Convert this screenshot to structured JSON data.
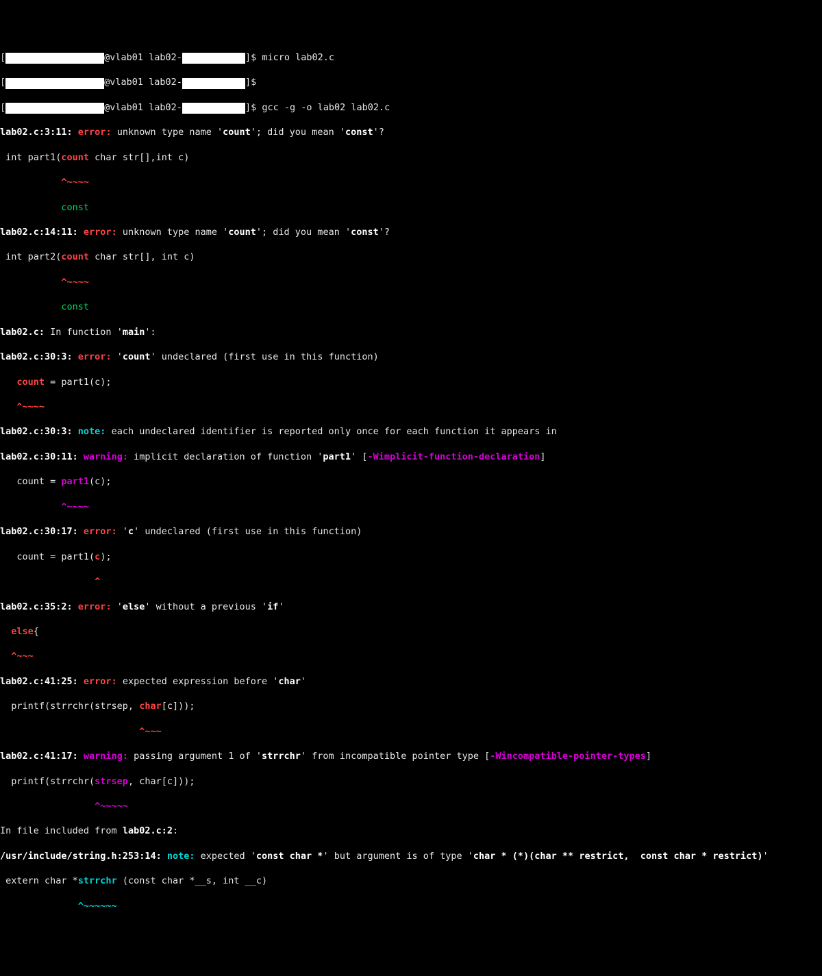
{
  "prompt": {
    "host": "@vlab01 lab02-",
    "dollar": "]$ ",
    "cmd1": "micro lab02.c",
    "cmd2": "",
    "cmd3": "gcc -g -o lab02 lab02.c"
  },
  "err1": {
    "loc": "lab02.c:3:11:",
    "tag": " error: ",
    "msg1": "unknown type name '",
    "kw": "count",
    "msg2": "'; did you mean '",
    "kw2": "const",
    "msg3": "'?",
    "code1": " int part1(",
    "hl": "count",
    "code2": " char str[],int c)",
    "caret": "           ^~~~~",
    "fix": "           const"
  },
  "err2": {
    "loc": "lab02.c:14:11:",
    "tag": " error: ",
    "msg1": "unknown type name '",
    "kw": "count",
    "msg2": "'; did you mean '",
    "kw2": "const",
    "msg3": "'?",
    "code1": " int part2(",
    "hl": "count",
    "code2": " char str[], int c)",
    "caret": "           ^~~~~",
    "fix": "           const"
  },
  "ctx": {
    "loc": "lab02.c:",
    "msg1": " In function '",
    "fn": "main",
    "msg2": "':"
  },
  "err3": {
    "loc": "lab02.c:30:3:",
    "tag": " error: ",
    "msg1": "'",
    "kw": "count",
    "msg2": "' undeclared (first use in this function)",
    "code1": "   ",
    "hl": "count",
    "code2": " = part1(c);",
    "caret": "   ^~~~~"
  },
  "note1": {
    "loc": "lab02.c:30:3:",
    "tag": " note: ",
    "msg": "each undeclared identifier is reported only once for each function it appears in"
  },
  "warn1": {
    "loc": "lab02.c:30:11:",
    "tag": " warning: ",
    "msg1": "implicit declaration of function '",
    "kw": "part1",
    "msg2": "' [",
    "flag": "-Wimplicit-function-declaration",
    "msg3": "]",
    "code1": "   count = ",
    "hl": "part1",
    "code2": "(c);",
    "caret": "           ^~~~~"
  },
  "err4": {
    "loc": "lab02.c:30:17:",
    "tag": " error: ",
    "msg1": "'",
    "kw": "c",
    "msg2": "' undeclared (first use in this function)",
    "code1": "   count = part1(",
    "hl": "c",
    "code2": ");",
    "caret": "                 ^"
  },
  "err5": {
    "loc": "lab02.c:35:2:",
    "tag": " error: ",
    "msg1": "'",
    "kw": "else",
    "msg2": "' without a previous '",
    "kw2": "if",
    "msg3": "'",
    "code1": "  ",
    "hl": "else",
    "code2": "{",
    "caret": "  ^~~~"
  },
  "err6": {
    "loc": "lab02.c:41:25:",
    "tag": " error: ",
    "msg1": "expected expression before '",
    "kw": "char",
    "msg2": "'",
    "code1": "  printf(strrchr(strsep, ",
    "hl": "char",
    "code2": "[c]));",
    "caret": "                         ^~~~"
  },
  "warn2": {
    "loc": "lab02.c:41:17:",
    "tag": " warning: ",
    "msg1": "passing argument 1 of '",
    "kw": "strrchr",
    "msg2": "' from incompatible pointer type [",
    "flag": "-Wincompatible-pointer-types",
    "msg3": "]",
    "code1": "  printf(strrchr(",
    "hl": "strsep",
    "code2": ", char[c]));",
    "caret": "                 ^~~~~~"
  },
  "inc": {
    "msg1": "In file included from ",
    "file": "lab02.c:2",
    "msg2": ":"
  },
  "note2": {
    "loc": "/usr/include/string.h:253:14:",
    "tag": " note: ",
    "msg1": "expected '",
    "t1": "const char *",
    "msg2": "' but argument is of type '",
    "t2": "char * (*)(char ** restrict,  const char * restrict)",
    "msg3": "'",
    "code1": " extern char *",
    "hl": "strrchr",
    "code2": " (const char *__s, int __c)",
    "caret": "              ^~~~~~~"
  }
}
